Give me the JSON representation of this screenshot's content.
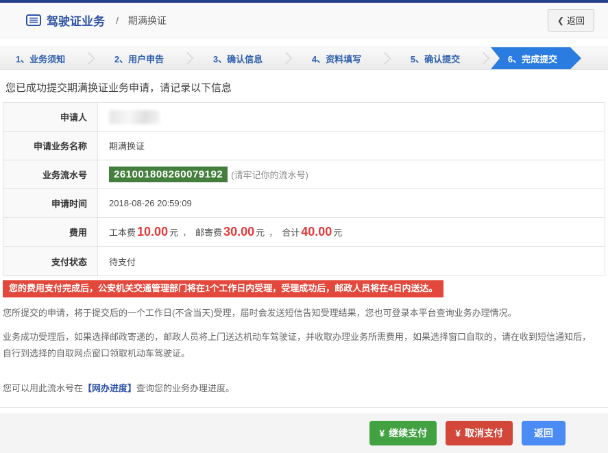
{
  "colors": {
    "topbar": "#233e8b",
    "brand_blue": "#2d52a5",
    "step_text_blue": "#2d5fad",
    "active_step_blue": "#2a7ce0",
    "serial_green": "#457f3e",
    "fee_red": "#e23b3b",
    "banner_red": "#e2483c",
    "button_green": "#42a242",
    "button_red": "#d2473a",
    "button_blue": "#4b8bf4"
  },
  "header": {
    "breadcrumb_root": "驾驶证业务",
    "breadcrumb_separator": "/",
    "breadcrumb_current": "期满换证",
    "back_icon": "❮",
    "back_label": "返回"
  },
  "steps": [
    {
      "label": "1、业务须知",
      "active": false
    },
    {
      "label": "2、用户申告",
      "active": false
    },
    {
      "label": "3、确认信息",
      "active": false
    },
    {
      "label": "4、资料填写",
      "active": false
    },
    {
      "label": "5、确认提交",
      "active": false
    },
    {
      "label": "6、完成提交",
      "active": true
    }
  ],
  "result": {
    "success_message": "您已成功提交期满换证业务申请，请记录以下信息",
    "rows": {
      "applicant": {
        "label": "申请人",
        "value_redacted": true
      },
      "business": {
        "label": "申请业务名称",
        "value": "期满换证"
      },
      "serial": {
        "label": "业务流水号",
        "number": "261001808260079192",
        "note": "(请牢记你的流水号)"
      },
      "time": {
        "label": "申请时间",
        "value": "2018-08-26 20:59:09"
      },
      "fee": {
        "label": "费用",
        "item1_label": "工本费",
        "item1_amount": "10.00",
        "item2_label": "邮寄费",
        "item2_amount": "30.00",
        "total_label": "合计",
        "total_amount": "40.00",
        "unit": "元",
        "separator": "，"
      },
      "payment": {
        "label": "支付状态",
        "value": "待支付"
      }
    }
  },
  "notices": {
    "banner": "您的费用支付完成后，公安机关交通管理部门将在1个工作日内受理，受理成功后，邮政人员将在4日内送达。",
    "paragraph1": "您所提交的申请，将于提交后的一个工作日(不含当天)受理，届时会发送短信告知受理结果，您也可登录本平台查询业务办理情况。",
    "paragraph2": "业务成功受理后，如果选择邮政寄递的，邮政人员将上门送达机动车驾驶证，并收取办理业务所需费用，如果选择窗口自取的，请在收到短信通知后，自行到选择的自取网点窗口领取机动车驾驶证。",
    "progress_prefix": "您可以用此流水号在",
    "progress_link": "【网办进度】",
    "progress_suffix": "查询您的业务办理进度。"
  },
  "footer": {
    "continue_pay": {
      "icon": "¥",
      "label": "继续支付"
    },
    "cancel_pay": {
      "icon": "¥",
      "label": "取消支付"
    },
    "back": {
      "label": "返回"
    }
  }
}
